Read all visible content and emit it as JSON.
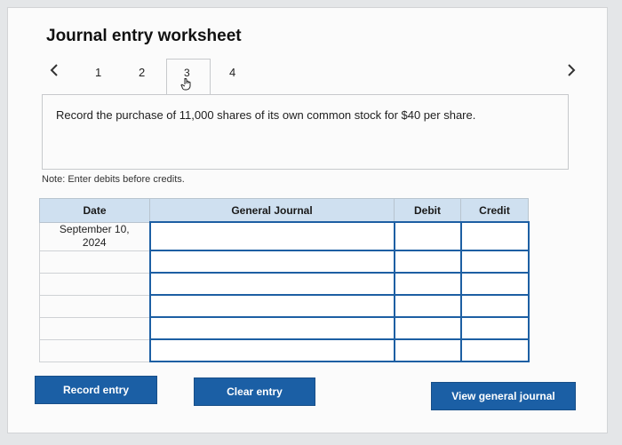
{
  "worksheet": {
    "title": "Journal entry worksheet",
    "tabs": [
      "1",
      "2",
      "3",
      "4"
    ],
    "active_tab": "3",
    "prev_icon": "chevron-left-icon",
    "next_icon": "chevron-right-icon",
    "cursor_icon": "pointer-hand-icon"
  },
  "instruction": {
    "text": "Record the purchase of 11,000 shares of its own common stock for $40 per share."
  },
  "note": "Note: Enter debits before credits.",
  "journal_table": {
    "headers": {
      "date": "Date",
      "account": "General Journal",
      "debit": "Debit",
      "credit": "Credit"
    },
    "rows": [
      {
        "date_line1": "September 10,",
        "date_line2": "2024",
        "account": "",
        "debit": "",
        "credit": ""
      },
      {
        "date_line1": "",
        "date_line2": "",
        "account": "",
        "debit": "",
        "credit": ""
      },
      {
        "date_line1": "",
        "date_line2": "",
        "account": "",
        "debit": "",
        "credit": ""
      },
      {
        "date_line1": "",
        "date_line2": "",
        "account": "",
        "debit": "",
        "credit": ""
      },
      {
        "date_line1": "",
        "date_line2": "",
        "account": "",
        "debit": "",
        "credit": ""
      },
      {
        "date_line1": "",
        "date_line2": "",
        "account": "",
        "debit": "",
        "credit": ""
      }
    ]
  },
  "buttons": {
    "record": "Record entry",
    "clear": "Clear entry",
    "view": "View general journal"
  },
  "colors": {
    "accent": "#1b5fa5",
    "header_bg": "#cfe0f0"
  }
}
